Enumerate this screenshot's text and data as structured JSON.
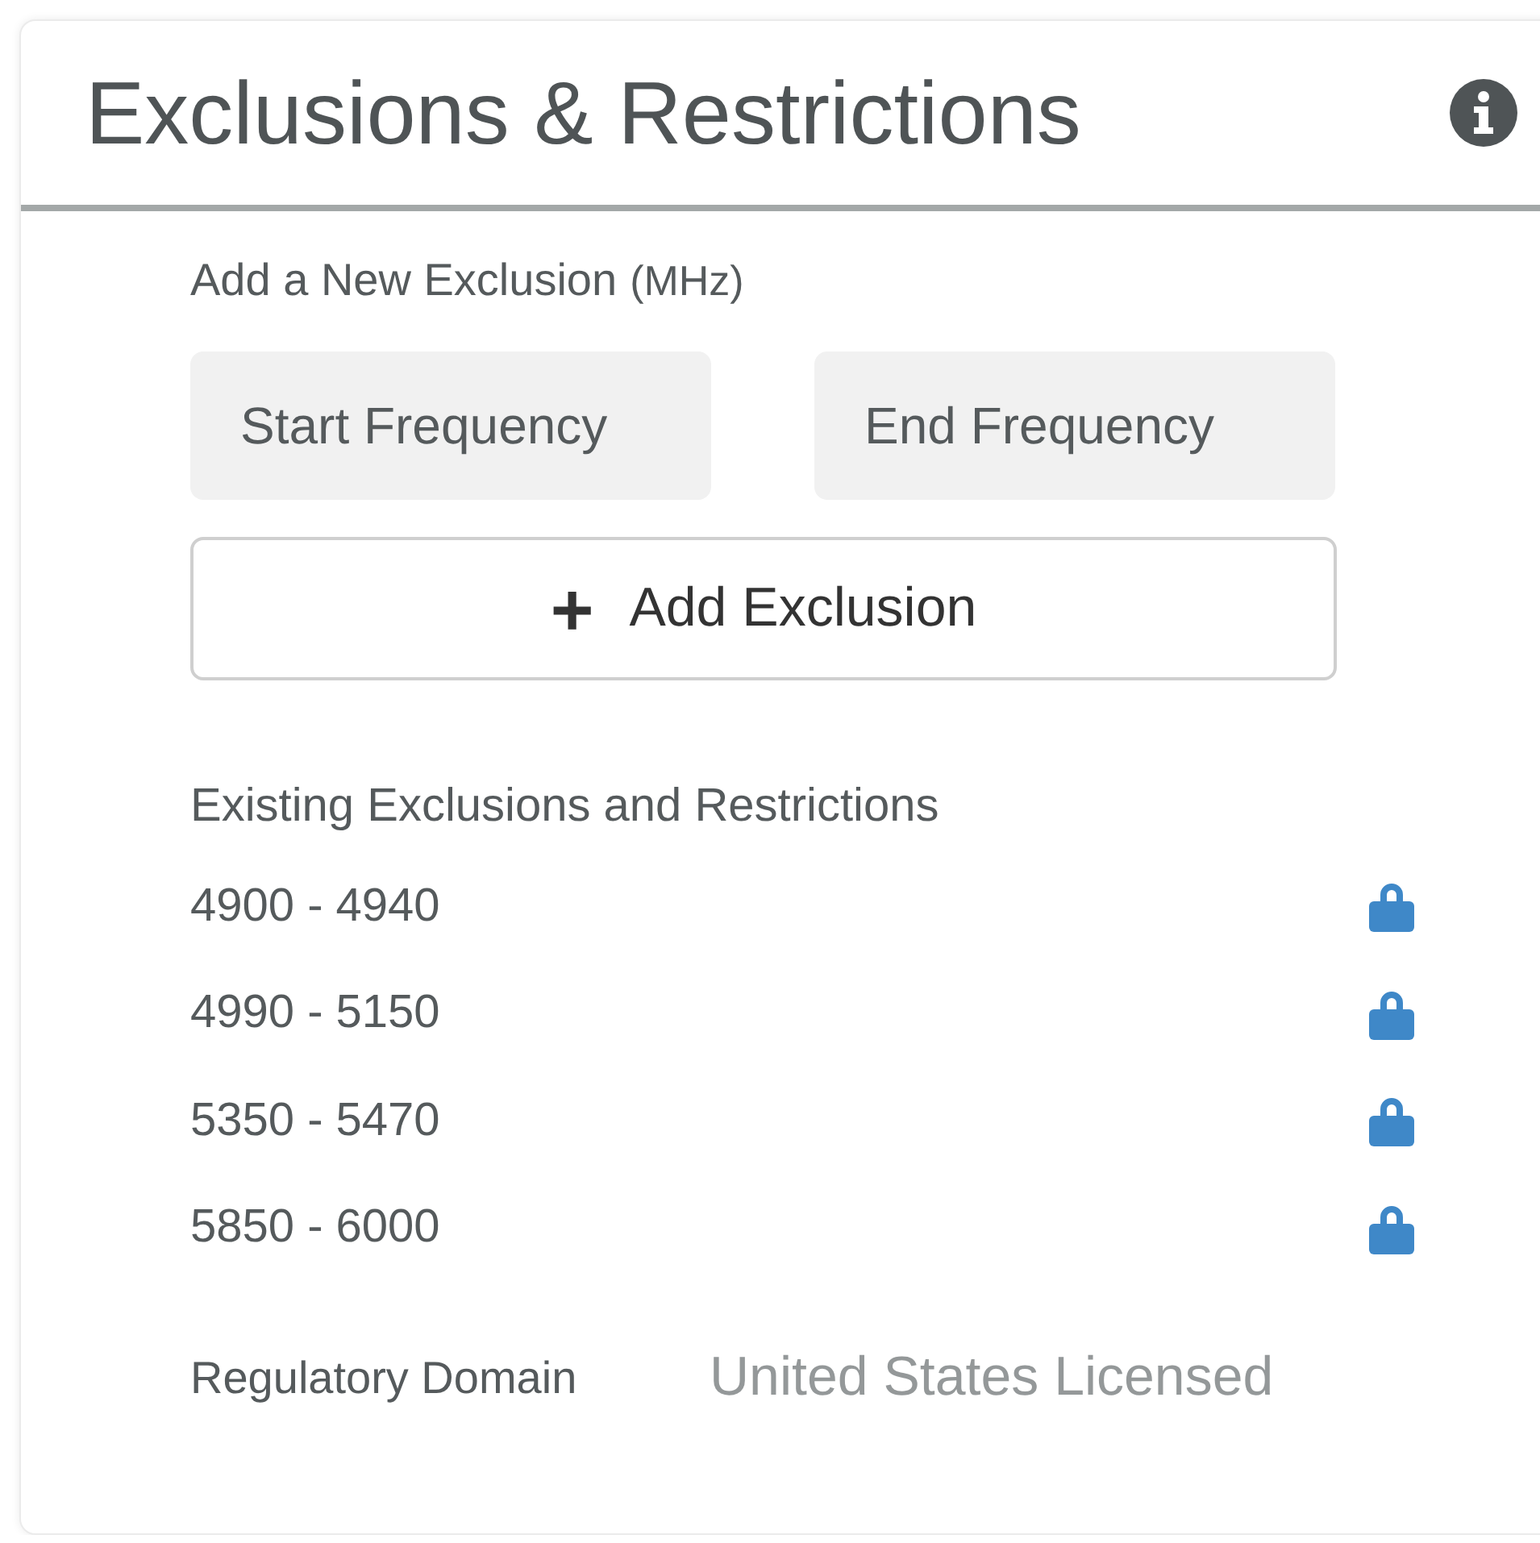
{
  "panel": {
    "title": "Exclusions & Restrictions"
  },
  "new_exclusion": {
    "label": "Add a New Exclusion",
    "unit": "(MHz)",
    "start_field": {
      "placeholder": "Start Frequency"
    },
    "end_field": {
      "placeholder": "End Frequency"
    },
    "add_button": {
      "icon": "+",
      "label": "Add Exclusion"
    }
  },
  "existing": {
    "heading": "Existing Exclusions and Restrictions",
    "items": [
      {
        "range": "4900 - 4940",
        "locked": true
      },
      {
        "range": "4990 - 5150",
        "locked": true
      },
      {
        "range": "5350 - 5470",
        "locked": true
      },
      {
        "range": "5850 - 6000",
        "locked": true
      }
    ]
  },
  "regulatory_domain": {
    "label": "Regulatory Domain",
    "value": "United States Licensed"
  }
}
